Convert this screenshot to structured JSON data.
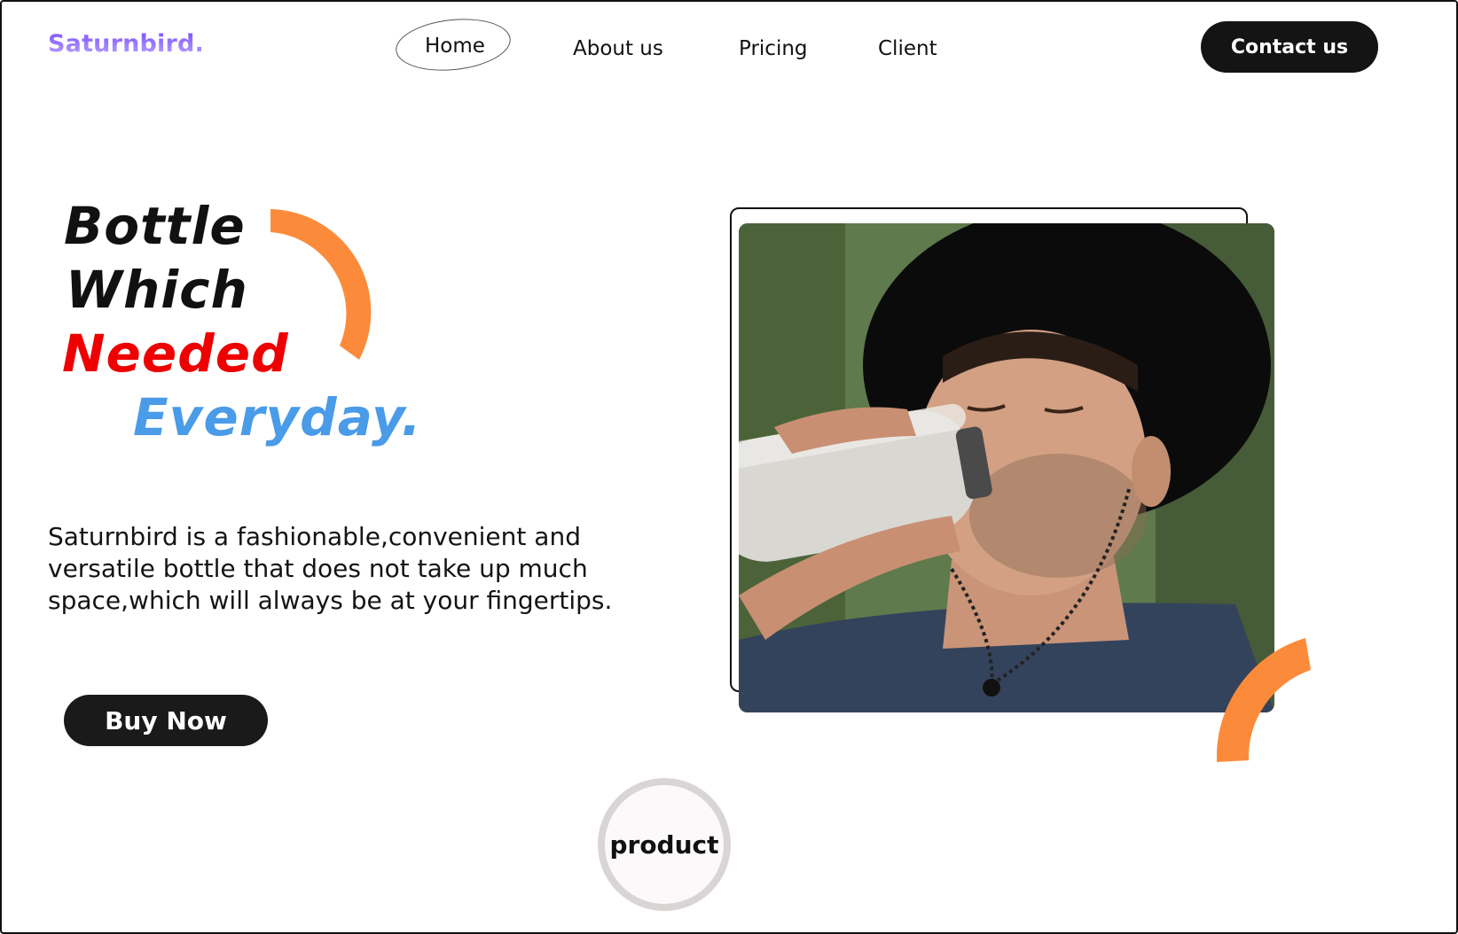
{
  "header": {
    "logo": "Saturnbird.",
    "nav": [
      {
        "label": "Home",
        "active": true
      },
      {
        "label": "About us",
        "active": false
      },
      {
        "label": "Pricing",
        "active": false
      },
      {
        "label": "Client",
        "active": false
      }
    ],
    "contact_label": "Contact us"
  },
  "hero": {
    "headline": [
      "Bottle",
      "Which",
      "Needed",
      "Everyday."
    ],
    "headline_colors": [
      "#111111",
      "#111111",
      "#ee0000",
      "#4a9be8"
    ],
    "description": "Saturnbird is a fashionable,convenient and versatile bottle that does not take up much space,which will always be at your fingertips.",
    "buy_label": "Buy Now",
    "image_subject": "man-drinking-from-bottle"
  },
  "product_badge": "product",
  "colors": {
    "accent_orange": "#fb8b3a",
    "logo_purple": "#8a5cf6",
    "dark": "#141414"
  }
}
